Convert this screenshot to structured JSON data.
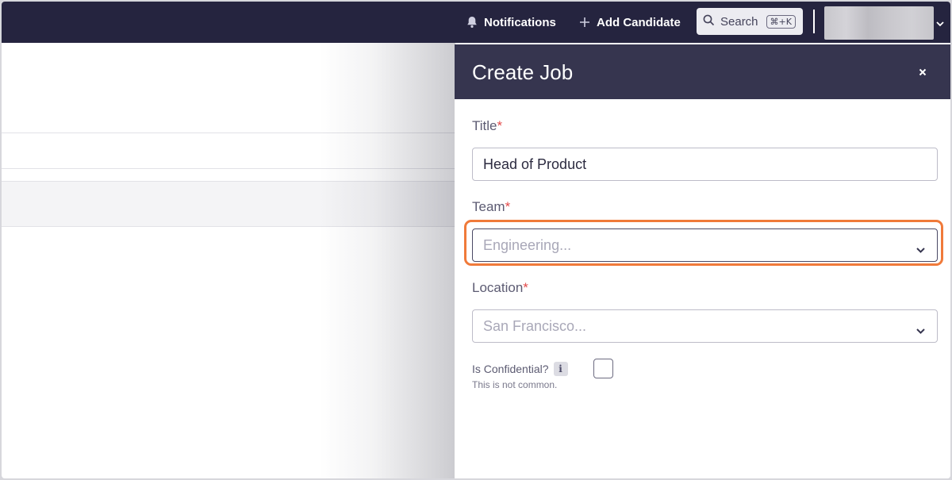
{
  "topbar": {
    "notifications_label": "Notifications",
    "add_candidate_label": "Add Candidate",
    "search_label": "Search",
    "search_shortcut": "⌘+K",
    "background_color": "#25243f"
  },
  "drawer": {
    "title": "Create Job",
    "close_icon": "×",
    "fields": {
      "title": {
        "label": "Title",
        "required_mark": "*",
        "value": "Head of Product"
      },
      "team": {
        "label": "Team",
        "required_mark": "*",
        "placeholder": "Engineering..."
      },
      "location": {
        "label": "Location",
        "required_mark": "*",
        "placeholder": "San Francisco..."
      },
      "confidential": {
        "label": "Is Confidential?",
        "info_icon": "i",
        "hint": "This is not common.",
        "checked": false
      }
    }
  },
  "colors": {
    "drawer_header": "#36354f",
    "required": "#e34a4a",
    "highlight": "#f07a3a"
  }
}
